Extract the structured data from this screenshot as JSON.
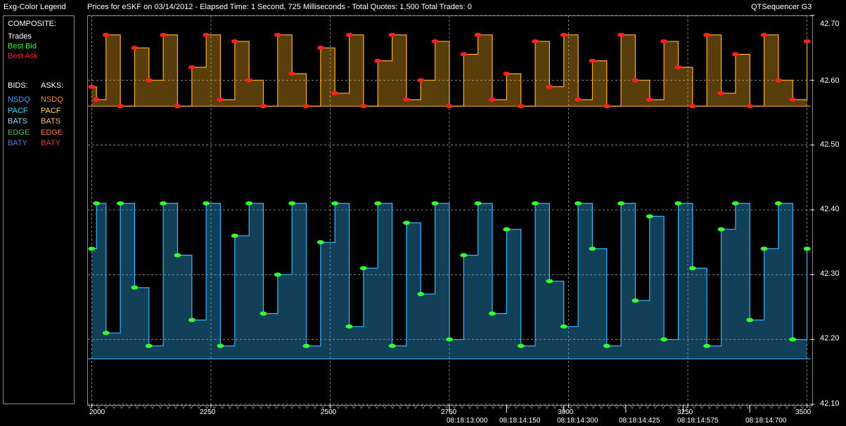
{
  "window": {
    "legend_title": "Exg-Color Legend",
    "chart_title": "Prices for  eSKF  on  03/14/2012  -  Elapsed Time: 1 Second, 725 Milliseconds  -  Total Quotes: 1,500  Total Trades: 0",
    "app_name": "QTSequencer G3"
  },
  "legend": {
    "composite_label": "COMPOSITE:",
    "composite": [
      {
        "label": "Trades",
        "color": "#ffffff"
      },
      {
        "label": "Best Bid",
        "color": "#33ff33"
      },
      {
        "label": "Best Ask",
        "color": "#ff2020"
      }
    ],
    "bids_label": "BIDS:",
    "asks_label": "ASKS:",
    "bids": [
      {
        "label": "NSDQ",
        "color": "#3aa0ff"
      },
      {
        "label": "PACF",
        "color": "#40e0ff"
      },
      {
        "label": "BATS",
        "color": "#a0d8ff"
      },
      {
        "label": "EDGE",
        "color": "#5cb85c"
      },
      {
        "label": "BATY",
        "color": "#5a7adf"
      }
    ],
    "asks": [
      {
        "label": "NSDQ",
        "color": "#ff8a1e"
      },
      {
        "label": "PACF",
        "color": "#ffe060"
      },
      {
        "label": "BATS",
        "color": "#ffc080"
      },
      {
        "label": "EDGE",
        "color": "#ff7050"
      },
      {
        "label": "BATY",
        "color": "#e04040"
      }
    ]
  },
  "chart_data": {
    "type": "line",
    "x_ticks": [
      "2000",
      "2250",
      "2500",
      "2750",
      "3000",
      "3250",
      "3500"
    ],
    "x_tick_values": [
      2000,
      2250,
      2500,
      2750,
      3000,
      3250,
      3500
    ],
    "time_labels": [
      "08:18:13:000",
      "08:18:14:150",
      "08:18:14:300",
      "08:18:14:425",
      "08:18:14:575",
      "08:18:14:700"
    ],
    "time_label_positions": [
      2750,
      2870,
      2990,
      3120,
      3240,
      3380
    ],
    "y_ticks": [
      "42.70",
      "42.60",
      "42.50",
      "42.40",
      "42.30",
      "42.20",
      "42.10"
    ],
    "y_tick_values": [
      42.7,
      42.6,
      42.5,
      42.4,
      42.3,
      42.2,
      42.1
    ],
    "xlim": [
      1992,
      3508
    ],
    "ylim": [
      42.1,
      42.7
    ],
    "grid": true,
    "series": [
      {
        "name": "Best Ask",
        "color": "#ff2020",
        "x": [
          2000,
          2010,
          2030,
          2060,
          2090,
          2120,
          2150,
          2180,
          2210,
          2240,
          2270,
          2300,
          2330,
          2360,
          2390,
          2420,
          2450,
          2480,
          2510,
          2540,
          2570,
          2600,
          2630,
          2660,
          2690,
          2720,
          2750,
          2780,
          2810,
          2840,
          2870,
          2900,
          2930,
          2960,
          2990,
          3020,
          3050,
          3080,
          3110,
          3140,
          3170,
          3200,
          3230,
          3260,
          3290,
          3320,
          3350,
          3380,
          3410,
          3440,
          3470,
          3500
        ],
        "values": [
          42.59,
          42.57,
          42.67,
          42.56,
          42.65,
          42.6,
          42.67,
          42.56,
          42.62,
          42.67,
          42.57,
          42.66,
          42.6,
          42.56,
          42.67,
          42.61,
          42.56,
          42.65,
          42.58,
          42.67,
          42.56,
          42.63,
          42.67,
          42.57,
          42.6,
          42.66,
          42.56,
          42.64,
          42.67,
          42.57,
          42.61,
          42.56,
          42.66,
          42.59,
          42.67,
          42.57,
          42.63,
          42.56,
          42.67,
          42.6,
          42.57,
          42.66,
          42.62,
          42.56,
          42.67,
          42.58,
          42.64,
          42.56,
          42.67,
          42.6,
          42.57,
          42.66
        ]
      },
      {
        "name": "Best Bid",
        "color": "#33ff33",
        "x": [
          2000,
          2010,
          2030,
          2060,
          2090,
          2120,
          2150,
          2180,
          2210,
          2240,
          2270,
          2300,
          2330,
          2360,
          2390,
          2420,
          2450,
          2480,
          2510,
          2540,
          2570,
          2600,
          2630,
          2660,
          2690,
          2720,
          2750,
          2780,
          2810,
          2840,
          2870,
          2900,
          2930,
          2960,
          2990,
          3020,
          3050,
          3080,
          3110,
          3140,
          3170,
          3200,
          3230,
          3260,
          3290,
          3320,
          3350,
          3380,
          3410,
          3440,
          3470,
          3500
        ],
        "values": [
          42.34,
          42.41,
          42.21,
          42.41,
          42.28,
          42.19,
          42.41,
          42.33,
          42.23,
          42.41,
          42.19,
          42.36,
          42.41,
          42.24,
          42.3,
          42.41,
          42.19,
          42.35,
          42.41,
          42.22,
          42.31,
          42.41,
          42.19,
          42.38,
          42.27,
          42.41,
          42.2,
          42.33,
          42.41,
          42.24,
          42.37,
          42.19,
          42.41,
          42.29,
          42.22,
          42.41,
          42.34,
          42.19,
          42.41,
          42.26,
          42.39,
          42.2,
          42.41,
          42.31,
          42.19,
          42.37,
          42.41,
          42.23,
          42.34,
          42.41,
          42.2,
          42.34
        ]
      }
    ],
    "area_series": [
      {
        "name": "ASKS",
        "color": "#ffb020",
        "baseline": 42.56
      },
      {
        "name": "BIDS",
        "color": "#35b8ff",
        "baseline": 42.17
      }
    ]
  }
}
